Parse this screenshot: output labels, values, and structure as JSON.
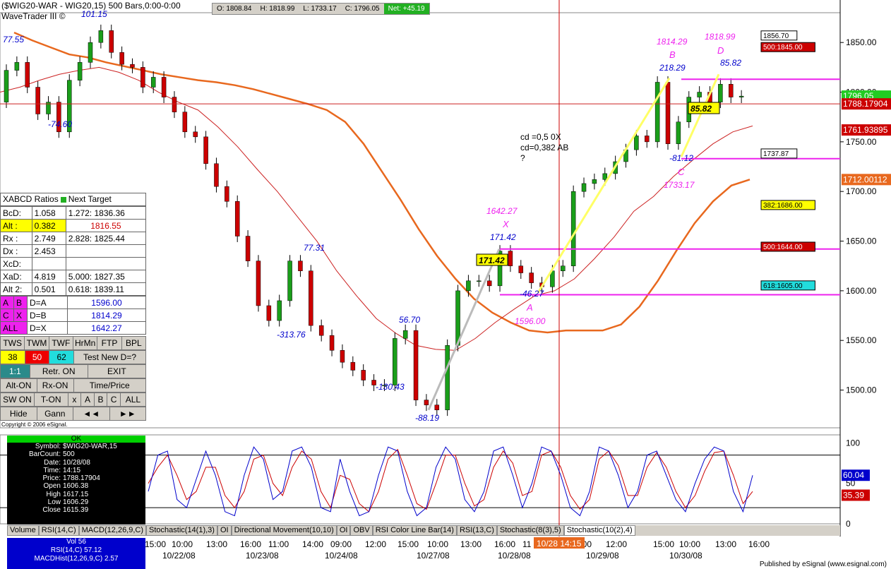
{
  "header": {
    "title": "($WIG20-WAR - WIG20,15) 500 Bars,0:00-0:00",
    "subtitle": "WaveTrader III ©",
    "ohlc": [
      "O: 1808.84",
      "H: 1818.99",
      "L: 1733.17",
      "C: 1796.05"
    ],
    "net": "Net: +45.19"
  },
  "copyright": "Copyright © 2006 eSignal.",
  "published": "Published by eSignal (www.esignal.com)",
  "colors": {
    "up": "#1a9e1a",
    "down": "#cc0000",
    "ma_thick": "#e8681e",
    "ma_thin": "#cc2222",
    "magenta": "#ee22ee",
    "blue": "#0000cc",
    "stoch_k": "#0000cc",
    "stoch_d": "#cc0000"
  },
  "xabcd": {
    "title": "XABCD Ratios",
    "next_target": "Next Target",
    "rows": [
      [
        "BcD:",
        "1.058",
        "1.272: 1836.36"
      ],
      [
        "Alt  :",
        "0.382",
        "1816.55"
      ],
      [
        "Rx  :",
        "2.749",
        "2.828: 1825.44"
      ],
      [
        "Dx  :",
        "2.453",
        ""
      ],
      [
        "XcD:",
        "",
        ""
      ],
      [
        "XaD:",
        "4.819",
        "5.000: 1827.35"
      ],
      [
        "Alt 2:",
        "0.501",
        "0.618: 1839.11"
      ]
    ],
    "targets": [
      [
        "A",
        "B",
        "D=A",
        "1596.00"
      ],
      [
        "C",
        "X",
        "D=B",
        "1814.29"
      ],
      [
        "ALL",
        "",
        "D=X",
        "1642.27"
      ]
    ]
  },
  "buttons": {
    "row1": [
      "TWS",
      "TWM",
      "TWF",
      "HrMn",
      "FTP",
      "BPL"
    ],
    "row2": [
      "38",
      "50",
      "62",
      "Test New D=?"
    ],
    "row3": [
      "1:1",
      "Retr. ON",
      "EXIT"
    ],
    "row4": [
      "Alt-ON",
      "Rx-ON",
      "Time/Price"
    ],
    "row5": [
      "SW ON",
      "T-ON",
      "x",
      "A",
      "B",
      "C",
      "ALL"
    ],
    "row6": [
      "Hide",
      "Gann",
      "◄◄",
      "►►"
    ]
  },
  "info": {
    "ok": "OK",
    "rows": [
      [
        "Symbol:",
        "$WIG20-WAR,15"
      ],
      [
        "BarCount:",
        "500"
      ],
      [
        "Date:",
        "10/28/08"
      ],
      [
        "Time:",
        "14:15"
      ],
      [
        "Price:",
        "1788.17904"
      ],
      [
        "Open",
        "1606.38"
      ],
      [
        "High",
        "1617.15"
      ],
      [
        "Low",
        "1606.29"
      ],
      [
        "Close",
        "1615.39"
      ]
    ]
  },
  "bottom_info": [
    "Vol 56",
    "RSI(14,C) 57.12",
    "MACDHist(12,26,9,C) 2.57"
  ],
  "tabs": [
    "Volume",
    "RSI(14,C)",
    "MACD(12,26,9,C)",
    "Stochastic(14(1),3)",
    "OI",
    "Directional Movement(10,10)",
    "OI",
    "OBV",
    "RSI Color Line Bar(14)",
    "RSI(13,C)",
    "Stochastic(8(3),5)",
    "Stochastic(10(2),4)"
  ],
  "chart_data": {
    "type": "candlestick",
    "y_ticks": [
      "1850.00",
      "1800.00",
      "1750.00",
      "1700.00",
      "1650.00",
      "1600.00",
      "1550.00",
      "1500.00"
    ],
    "y_tick_values": [
      1850,
      1800,
      1750,
      1700,
      1650,
      1600,
      1550,
      1500
    ],
    "ylim": [
      1462,
      1880
    ],
    "time_ticks": [
      "15:00",
      "10:00",
      "13:00",
      "16:00",
      "11:00",
      "14:00",
      "09:00",
      "12:00",
      "15:00",
      "10:00",
      "13:00",
      "16:00",
      "11",
      "09:00",
      "12:00",
      "15:00",
      "10:00",
      "13:00",
      "16:00"
    ],
    "date_ticks": [
      "10/22/08",
      "10/23/08",
      "10/24/08",
      "10/27/08",
      "10/28/08",
      "10/29/08",
      "10/30/08"
    ],
    "cursor_label": "10/28 14:15",
    "price_path": [
      1790,
      1822,
      1830,
      1805,
      1778,
      1790,
      1760,
      1812,
      1830,
      1850,
      1862,
      1840,
      1828,
      1825,
      1805,
      1815,
      1795,
      1780,
      1760,
      1755,
      1728,
      1705,
      1690,
      1655,
      1630,
      1585,
      1570,
      1590,
      1630,
      1620,
      1565,
      1555,
      1540,
      1528,
      1520,
      1510,
      1505,
      1505,
      1552,
      1560,
      1490,
      1485,
      1480,
      1545,
      1600,
      1610,
      1610,
      1605,
      1640,
      1625,
      1618,
      1608,
      1604,
      1620,
      1625,
      1700,
      1708,
      1712,
      1718,
      1730,
      1742,
      1756,
      1750,
      1810,
      1748,
      1770,
      1795,
      1800,
      1790,
      1808,
      1795,
      1796
    ],
    "ma_thick": [
      1860,
      1852,
      1845,
      1838,
      1835,
      1830,
      1826,
      1822,
      1818,
      1815,
      1812,
      1810,
      1807,
      1803,
      1798,
      1793,
      1788,
      1782,
      1770,
      1748,
      1720,
      1692,
      1662,
      1635,
      1612,
      1592,
      1578,
      1568,
      1560,
      1558,
      1560,
      1560,
      1560,
      1566,
      1584,
      1610,
      1640,
      1668,
      1690,
      1706,
      1712
    ],
    "ma_thin": [
      1800,
      1805,
      1812,
      1818,
      1822,
      1825,
      1820,
      1812,
      1800,
      1790,
      1782,
      1765,
      1745,
      1722,
      1700,
      1675,
      1650,
      1620,
      1595,
      1572,
      1557,
      1545,
      1541,
      1540,
      1552,
      1568,
      1582,
      1595,
      1600,
      1612,
      1632,
      1654,
      1680,
      1695,
      1715,
      1732,
      1748,
      1760,
      1766
    ],
    "patterns": [
      {
        "label": "1642.27",
        "point": "X"
      },
      {
        "label": "-46.27",
        "point": "A",
        "value": "1596.00"
      },
      {
        "label": "1814.29",
        "point": "B",
        "extra": "218.29"
      },
      {
        "label": "1733.17",
        "point": "C",
        "extra": "-81.12"
      },
      {
        "label": "1818.99",
        "point": "D",
        "extra": "85.82"
      }
    ],
    "swing_labels": [
      "77.55",
      "101.15",
      "-74.60",
      "77.31",
      "-313.76",
      "56.70",
      "-130.43",
      "-88.19",
      "171.42",
      "-46.27",
      "218.29",
      "85.82",
      "-81.12"
    ],
    "boxed_labels": [
      "171.42",
      "85.82"
    ],
    "notes": [
      "cd =0,5 0X",
      "cd=0,382 AB",
      "?"
    ],
    "levels": [
      {
        "label": "500:1845.00",
        "value": 1845,
        "bg": "#cc0000",
        "fg": "#ffffff"
      },
      {
        "label": "1856.70",
        "value": 1856.7,
        "bg": "#ffffff",
        "fg": "#000000"
      },
      {
        "label": "1737.87",
        "value": 1737.87,
        "bg": "#ffffff",
        "fg": "#000000"
      },
      {
        "label": "382:1686.00",
        "value": 1686,
        "bg": "#ffff00",
        "fg": "#000000"
      },
      {
        "label": "500:1644.00",
        "value": 1644,
        "bg": "#cc0000",
        "fg": "#ffffff"
      },
      {
        "label": "618:1605.00",
        "value": 1605,
        "bg": "#22dddd",
        "fg": "#000000"
      }
    ],
    "axis_badges": [
      {
        "label": "1796.05",
        "value": 1796.05,
        "bg": "#22cc22",
        "fg": "#ffffff"
      },
      {
        "label": "1788.17904",
        "value": 1788.18,
        "bg": "#cc0000",
        "fg": "#ffffff"
      },
      {
        "label": "1761.93895",
        "value": 1761.94,
        "bg": "#cc0000",
        "fg": "#ffffff"
      },
      {
        "label": "1712.00112",
        "value": 1712,
        "bg": "#e8681e",
        "fg": "#ffffff"
      }
    ],
    "magenta_lines": [
      1813,
      1733,
      1642,
      1596
    ],
    "stochastic": {
      "y_ticks": [
        "100",
        "50",
        "0"
      ],
      "badges": [
        {
          "label": "60.04",
          "value": 60.04,
          "bg": "#0000cc"
        },
        {
          "label": "35.39",
          "value": 35.39,
          "bg": "#cc0000"
        }
      ],
      "k": [
        40,
        85,
        90,
        30,
        20,
        55,
        90,
        60,
        15,
        10,
        60,
        95,
        80,
        30,
        40,
        90,
        95,
        70,
        20,
        15,
        80,
        40,
        10,
        15,
        60,
        95,
        90,
        40,
        10,
        20,
        70,
        95,
        80,
        30,
        15,
        40,
        90,
        95,
        60,
        20,
        50,
        95,
        90,
        60,
        20,
        10,
        40,
        95,
        90,
        60,
        20,
        40,
        85,
        90,
        60,
        30,
        15,
        50,
        80,
        95,
        90,
        40,
        15,
        60
      ],
      "d": [
        50,
        70,
        85,
        60,
        30,
        40,
        70,
        70,
        35,
        20,
        40,
        80,
        85,
        50,
        35,
        70,
        90,
        80,
        40,
        20,
        60,
        55,
        25,
        15,
        40,
        80,
        92,
        60,
        25,
        18,
        50,
        85,
        85,
        50,
        22,
        30,
        70,
        90,
        75,
        35,
        40,
        85,
        90,
        70,
        35,
        18,
        30,
        80,
        90,
        72,
        35,
        35,
        70,
        88,
        70,
        40,
        20,
        35,
        65,
        88,
        90,
        60,
        25,
        40
      ]
    }
  }
}
